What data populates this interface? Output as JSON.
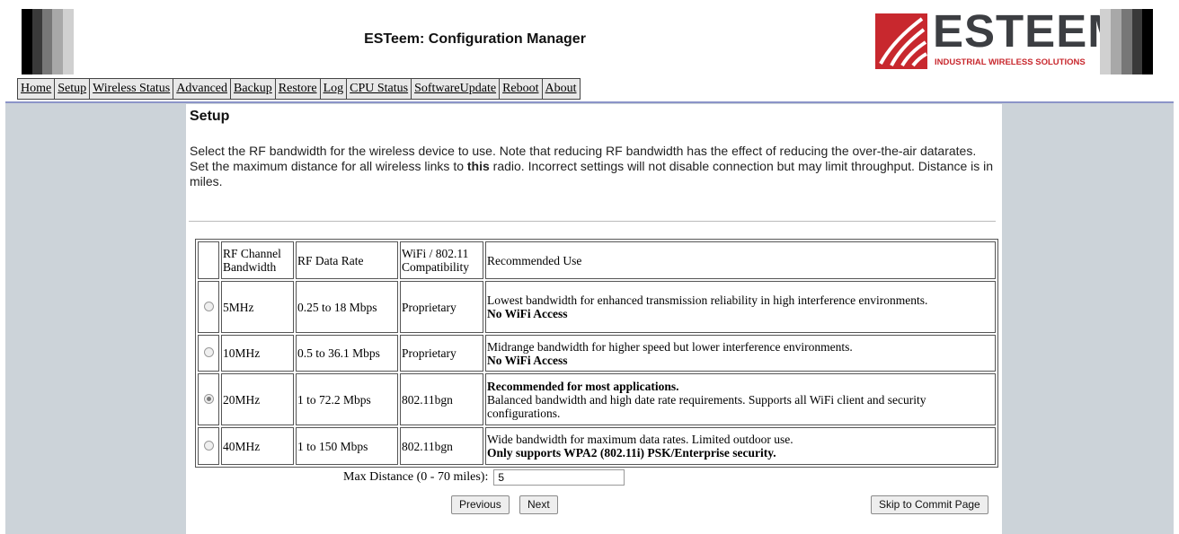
{
  "window": {
    "title": "ESTeem: Configuration Manager"
  },
  "brand": {
    "logo_text": "ESTEEM",
    "logo_tagline": "INDUSTRIAL WIRELESS SOLUTIONS",
    "accent_red": "#c8282e",
    "logo_gray": "#3c3e42",
    "nav_rule": "#8b94c8",
    "background": "#ccd3d9"
  },
  "nav": {
    "items": [
      "Home",
      "Setup",
      "Wireless Status",
      "Advanced",
      "Backup",
      "Restore",
      "Log",
      "CPU Status",
      "SoftwareUpdate",
      "Reboot",
      "About"
    ]
  },
  "main": {
    "title": "Setup",
    "intro_line1": "Select the RF bandwidth for the wireless device to use. Note that reducing RF bandwidth has the effect of reducing the over-the-air datarates.",
    "intro_line2_pre": "Set the maximum distance for all wireless links to ",
    "intro_line2_bold": "this",
    "intro_line2_post": " radio. Incorrect settings will not disable connection but may limit throughput. Distance is in miles."
  },
  "table": {
    "headers": {
      "bandwidth": "RF Channel Bandwidth",
      "rate": "RF Data Rate",
      "compat": "WiFi / 802.11 Compatibility",
      "use": "Recommended Use"
    },
    "rows": [
      {
        "bandwidth": "5MHz",
        "rate": "0.25 to 18 Mbps",
        "compat": "Proprietary",
        "use_lead": "",
        "use_text": "Lowest bandwidth for enhanced transmission reliability in high interference environments.",
        "use_bold": "No WiFi Access",
        "selected": false
      },
      {
        "bandwidth": "10MHz",
        "rate": "0.5 to 36.1 Mbps",
        "compat": "Proprietary",
        "use_lead": "",
        "use_text": "Midrange bandwidth for higher speed but lower interference environments.",
        "use_bold": "No WiFi Access",
        "selected": false
      },
      {
        "bandwidth": "20MHz",
        "rate": "1 to 72.2 Mbps",
        "compat": "802.11bgn",
        "use_lead": "Recommended for most applications.",
        "use_text": "Balanced bandwidth and high date rate requirements. Supports all WiFi client and security configurations.",
        "use_bold": "",
        "selected": true
      },
      {
        "bandwidth": "40MHz",
        "rate": "1 to 150 Mbps",
        "compat": "802.11bgn",
        "use_lead": "",
        "use_text": "Wide bandwidth for maximum data rates. Limited outdoor use.",
        "use_bold": "Only supports WPA2 (802.11i) PSK/Enterprise security.",
        "selected": false
      }
    ]
  },
  "distance": {
    "label": "Max Distance (0 - 70 miles):",
    "value": "5"
  },
  "buttons": {
    "previous": "Previous",
    "next": "Next",
    "skip": "Skip to Commit Page"
  }
}
